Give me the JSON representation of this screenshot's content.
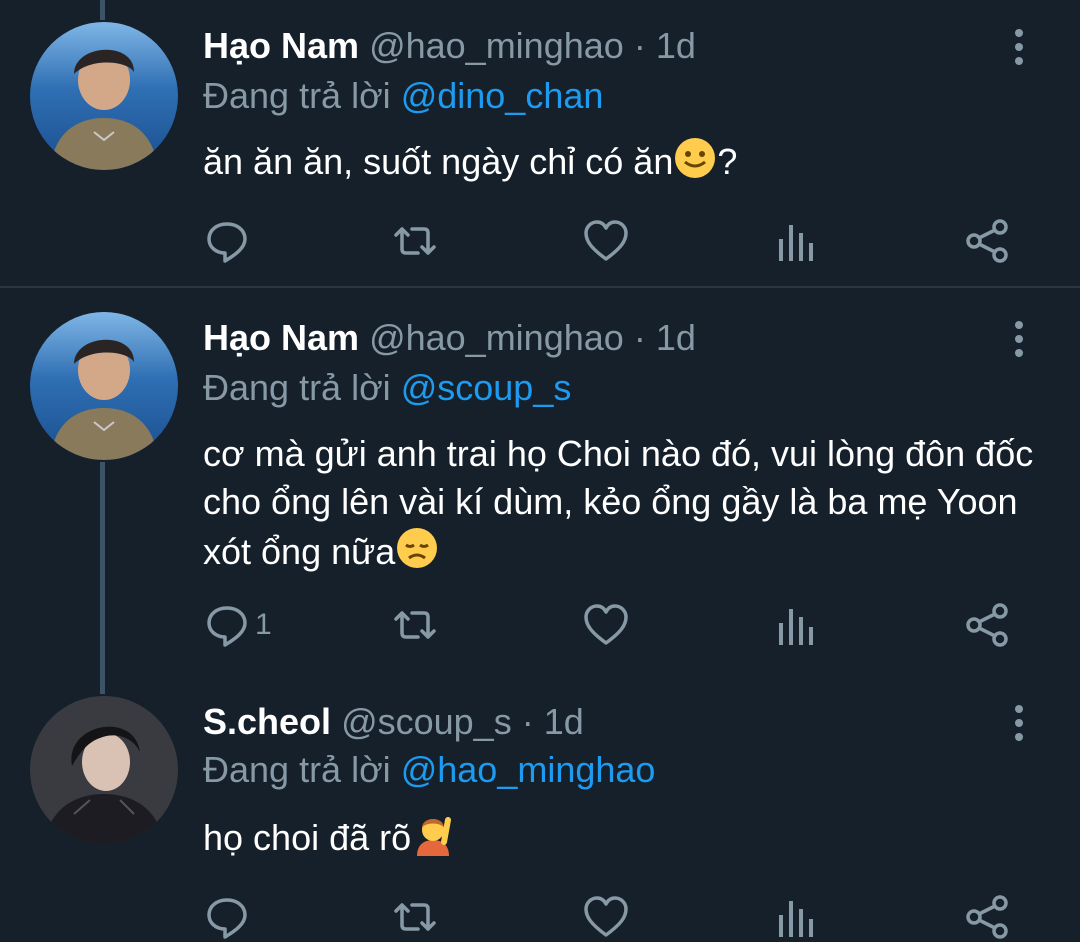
{
  "tweets": [
    {
      "name": "Hạo Nam",
      "handle": "@hao_minghao",
      "separator": "·",
      "time": "1d",
      "reply_prefix": "Đang trả lời",
      "reply_to": "@dino_chan",
      "text": "ăn ăn ăn, suốt ngày chỉ có ăn",
      "text_suffix": "?",
      "emoji": "slightly-smiling-face",
      "reply_count": ""
    },
    {
      "name": "Hạo Nam",
      "handle": "@hao_minghao",
      "separator": "·",
      "time": "1d",
      "reply_prefix": "Đang trả lời",
      "reply_to": "@scoup_s",
      "text": "cơ mà gửi anh trai họ Choi nào đó, vui lòng đôn đốc cho ổng lên vài kí dùm, kẻo ổng gầy là ba mẹ Yoon xót ổng nữa",
      "text_suffix": "",
      "emoji": "disappointed-face",
      "reply_count": "1"
    },
    {
      "name": "S.cheol",
      "handle": "@scoup_s",
      "separator": "·",
      "time": "1d",
      "reply_prefix": "Đang trả lời",
      "reply_to": "@hao_minghao",
      "text": "họ choi đã rõ",
      "text_suffix": "",
      "emoji": "person-raising-hand",
      "reply_count": ""
    }
  ],
  "icons": {
    "reply": "reply-icon",
    "retweet": "retweet-icon",
    "like": "like-icon",
    "analytics": "analytics-icon",
    "share": "share-icon",
    "more": "more-options-icon"
  },
  "colors": {
    "background": "#15202b",
    "secondary_text": "#8899a6",
    "mention": "#1d9bf0",
    "thread_line": "#3d5466"
  }
}
